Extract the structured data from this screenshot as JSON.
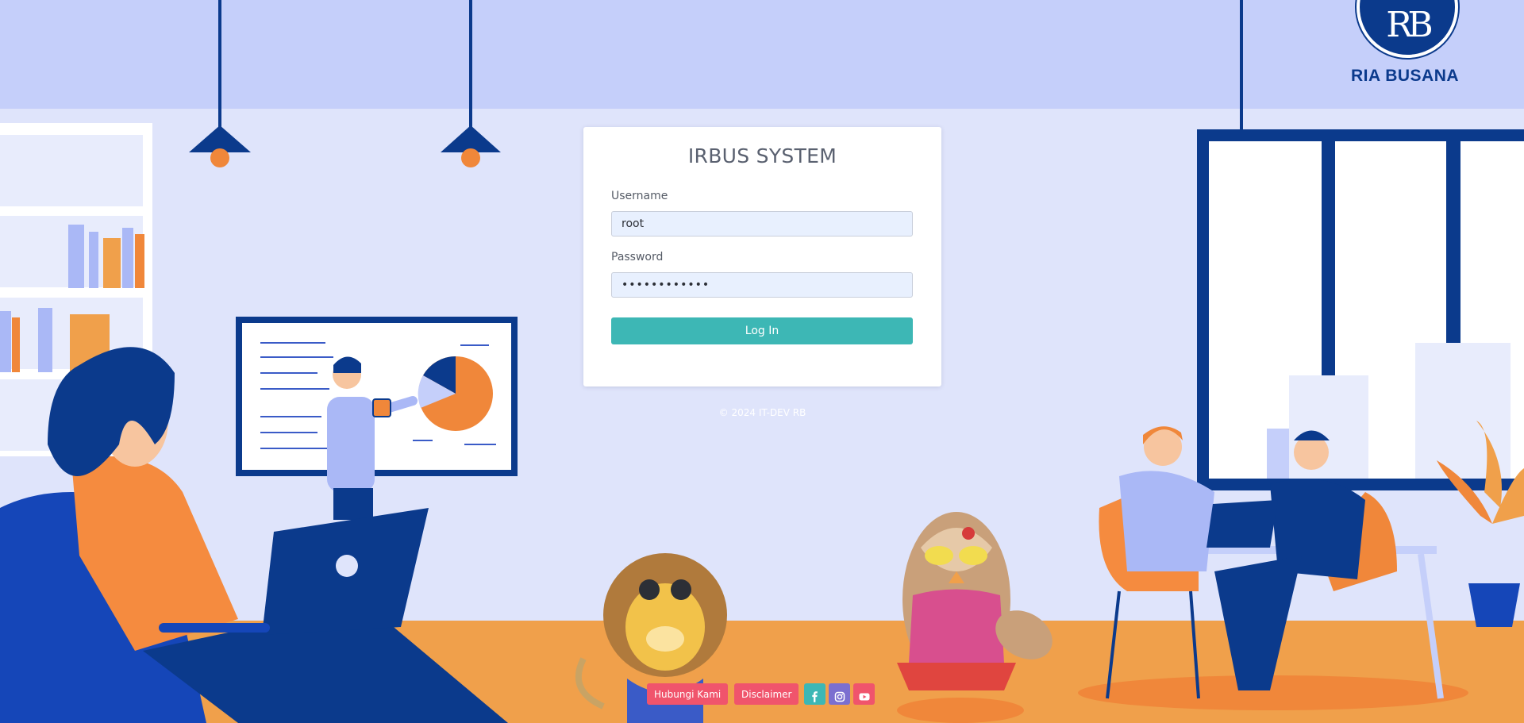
{
  "brand": {
    "monogram": "RB",
    "name": "RIA BUSANA",
    "color": "#0b3a8c"
  },
  "login": {
    "title": "IRBUS SYSTEM",
    "username_label": "Username",
    "username_value": "root",
    "password_label": "Password",
    "password_value": "••••••••••••",
    "submit_label": "Log In"
  },
  "footer": {
    "copyright": "© 2024 IT-DEV RB",
    "contact_label": "Hubungi Kami",
    "disclaimer_label": "Disclaimer",
    "social": [
      {
        "name": "facebook-icon",
        "color": "#3db7b5"
      },
      {
        "name": "instagram-icon",
        "color": "#7b6fd0"
      },
      {
        "name": "youtube-icon",
        "color": "#f0546c"
      }
    ]
  },
  "colors": {
    "accent": "#3db7b5",
    "footer_button": "#f0546c",
    "background": "#dfe4fb",
    "ceiling": "#c5cffa",
    "floor": "#f0a04b"
  }
}
